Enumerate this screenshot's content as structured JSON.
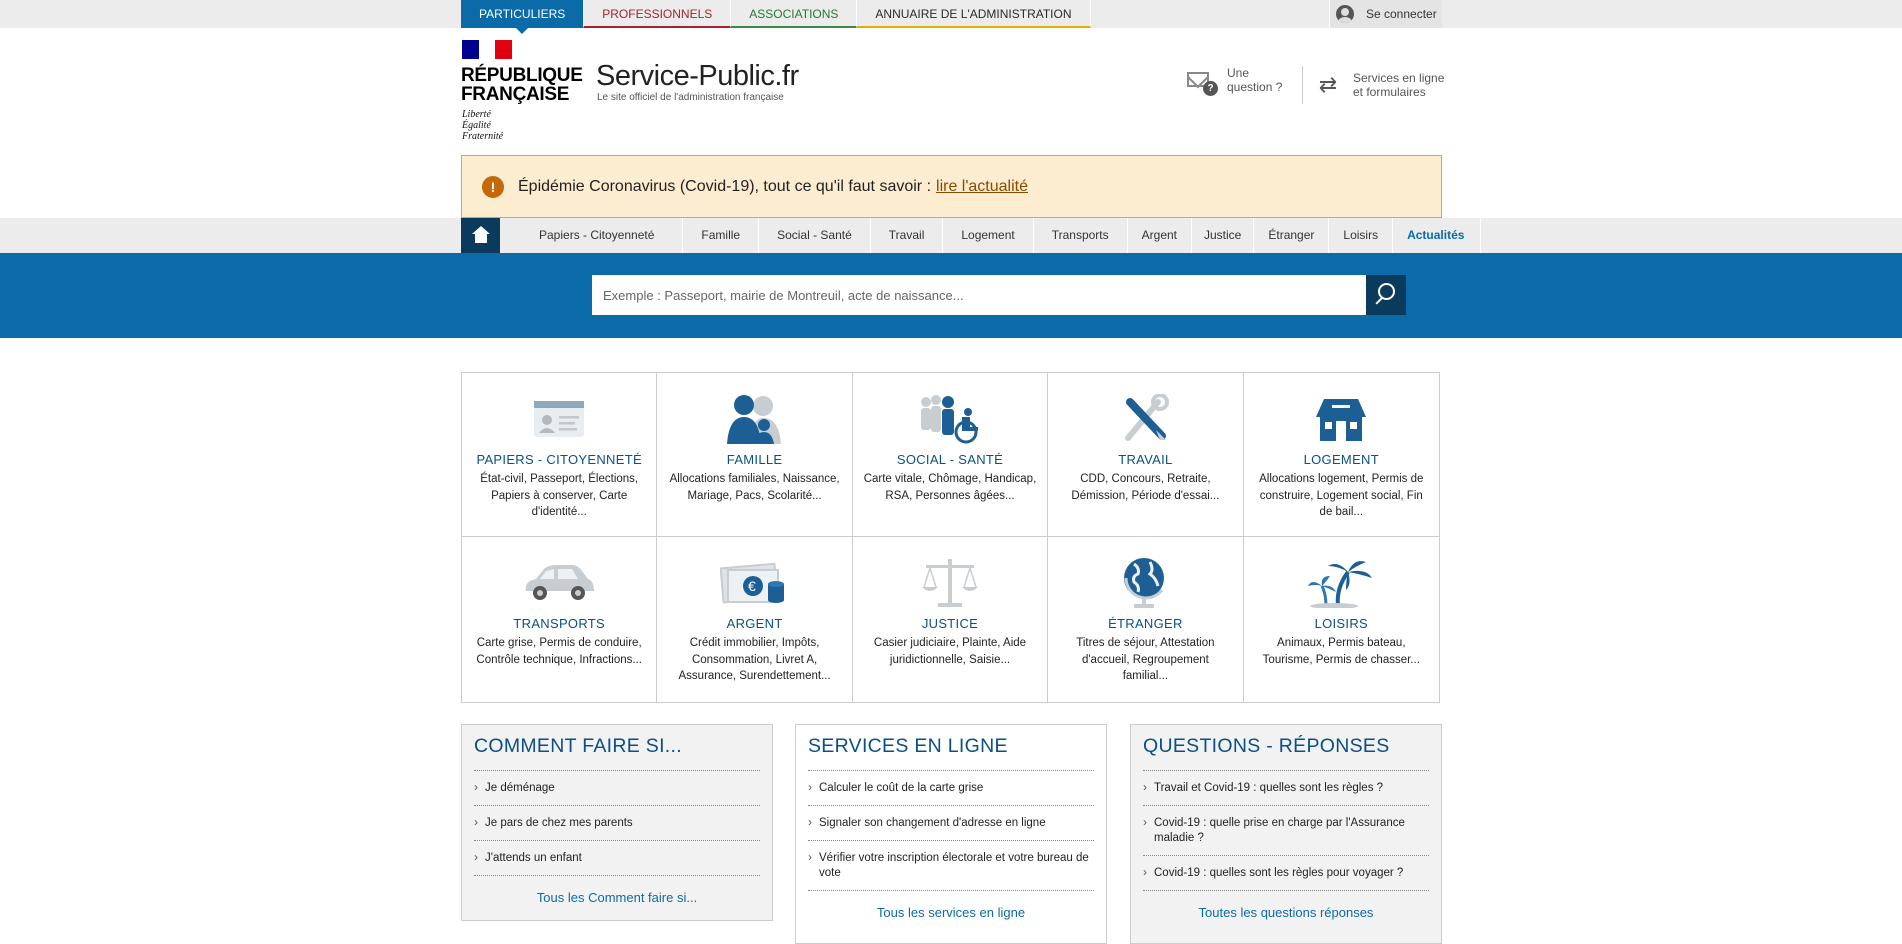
{
  "top_tabs": [
    "PARTICULIERS",
    "PROFESSIONNELS",
    "ASSOCIATIONS",
    "ANNUAIRE DE L'ADMINISTRATION"
  ],
  "login_label": "Se connecter",
  "header": {
    "rf_title": "RÉPUBLIQUE FRANÇAISE",
    "rf_motto": "Liberté Égalité Fraternité",
    "site_name": "Service-Public.fr",
    "site_subtitle": "Le site officiel de l'administration française",
    "question_link": "Une question ?",
    "services_link": "Services en ligne et formulaires",
    "flag_colors": [
      "#000091",
      "#ffffff",
      "#e1000f"
    ]
  },
  "alert": {
    "text": "Épidémie Coronavirus (Covid-19), tout ce qu'il faut savoir :",
    "link": "lire l'actualité"
  },
  "nav": {
    "home_icon": "home-icon",
    "items": [
      "Papiers - Citoyenneté",
      "Famille",
      "Social - Santé",
      "Travail",
      "Logement",
      "Transports",
      "Argent",
      "Justice",
      "Étranger",
      "Loisirs",
      "Actualités"
    ]
  },
  "search": {
    "placeholder": "Exemple : Passeport, mairie de Montreuil, acte de naissance...",
    "button_icon": "search-icon"
  },
  "themes": [
    {
      "title": "PAPIERS - CITOYENNETÉ",
      "desc": "État-civil, Passeport, Élections, Papiers à conserver, Carte d'identité...",
      "icon": "id-card-icon"
    },
    {
      "title": "FAMILLE",
      "desc": "Allocations familiales, Naissance, Mariage, Pacs, Scolarité...",
      "icon": "family-icon"
    },
    {
      "title": "SOCIAL - SANTÉ",
      "desc": "Carte vitale, Chômage, Handicap, RSA, Personnes âgées...",
      "icon": "social-icon"
    },
    {
      "title": "TRAVAIL",
      "desc": "CDD, Concours, Retraite, Démission, Période d'essai...",
      "icon": "tools-icon"
    },
    {
      "title": "LOGEMENT",
      "desc": "Allocations logement, Permis de construire, Logement social, Fin de bail...",
      "icon": "house-icon"
    },
    {
      "title": "TRANSPORTS",
      "desc": "Carte grise, Permis de conduire, Contrôle technique, Infractions...",
      "icon": "car-icon"
    },
    {
      "title": "ARGENT",
      "desc": "Crédit immobilier, Impôts, Consommation, Livret A, Assurance, Surendettement...",
      "icon": "money-icon"
    },
    {
      "title": "JUSTICE",
      "desc": "Casier judiciaire, Plainte, Aide juridictionnelle, Saisie...",
      "icon": "scales-icon"
    },
    {
      "title": "ÉTRANGER",
      "desc": "Titres de séjour, Attestation d'accueil, Regroupement familial...",
      "icon": "globe-icon"
    },
    {
      "title": "LOISIRS",
      "desc": "Animaux, Permis bateau, Tourisme, Permis de chasser...",
      "icon": "palm-tree-icon"
    }
  ],
  "boxes": [
    {
      "title": "COMMENT FAIRE SI...",
      "items": [
        "Je déménage",
        "Je pars de chez mes parents",
        "J'attends un enfant"
      ],
      "more": "Tous les Comment faire si..."
    },
    {
      "title": "SERVICES EN LIGNE",
      "items": [
        "Calculer le coût de la carte grise",
        "Signaler son changement d'adresse en ligne",
        "Vérifier votre inscription électorale et votre bureau de vote"
      ],
      "more": "Tous les services en ligne"
    },
    {
      "title": "QUESTIONS - RÉPONSES",
      "items": [
        "Travail et Covid-19 : quelles sont les règles ?",
        "Covid-19 : quelle prise en charge par l'Assurance maladie ?",
        "Covid-19 : quelles sont les règles pour voyager ?"
      ],
      "more": "Toutes les questions réponses"
    }
  ]
}
